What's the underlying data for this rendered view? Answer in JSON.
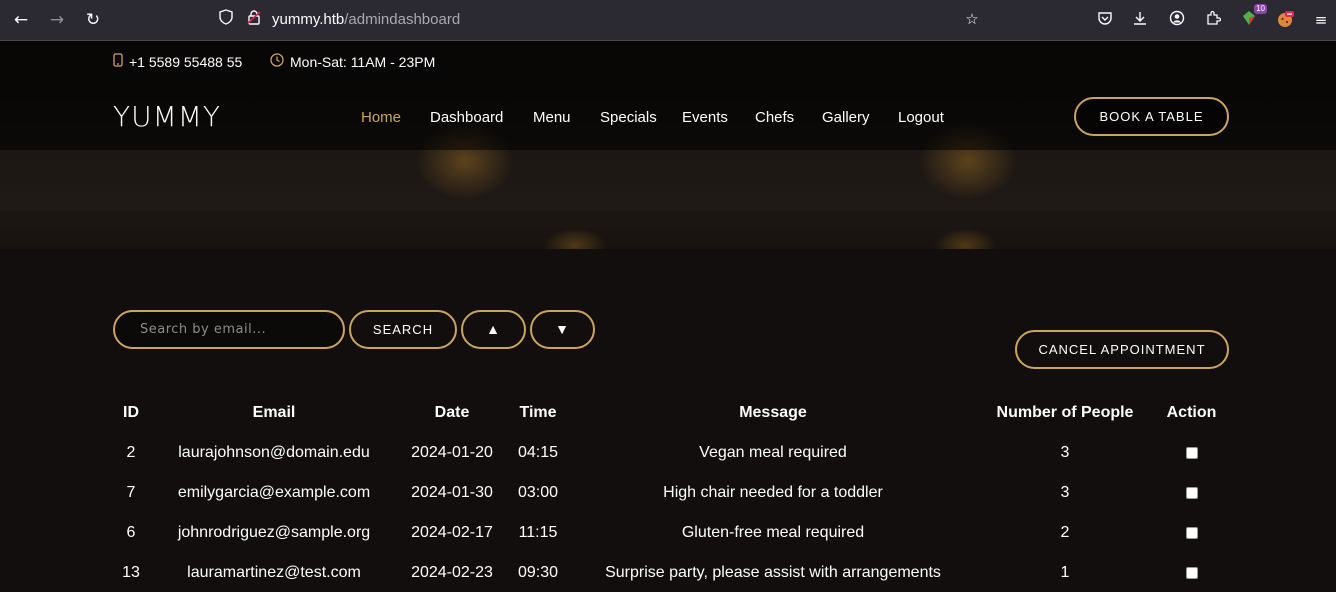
{
  "browser": {
    "url_host": "yummy.htb",
    "url_path": "/admindashboard",
    "extensions_badge": "10"
  },
  "topbar": {
    "phone": "+1 5589 55488 55",
    "hours": "Mon-Sat: 11AM - 23PM"
  },
  "header": {
    "logo": "YUMMY",
    "nav": [
      "Home",
      "Dashboard",
      "Menu",
      "Specials",
      "Events",
      "Chefs",
      "Gallery",
      "Logout"
    ],
    "book_button": "BOOK A TABLE"
  },
  "controls": {
    "search_placeholder": "Search by email...",
    "search_button": "SEARCH",
    "sort_up": "▲",
    "sort_down": "▼",
    "cancel_button": "CANCEL APPOINTMENT"
  },
  "table": {
    "headers": [
      "ID",
      "Email",
      "Date",
      "Time",
      "Message",
      "Number of People",
      "Action"
    ],
    "rows": [
      [
        "2",
        "laurajohnson@domain.edu",
        "2024-01-20",
        "04:15",
        "Vegan meal required",
        "3"
      ],
      [
        "7",
        "emilygarcia@example.com",
        "2024-01-30",
        "03:00",
        "High chair needed for a toddler",
        "3"
      ],
      [
        "6",
        "johnrodriguez@sample.org",
        "2024-02-17",
        "11:15",
        "Gluten-free meal required",
        "2"
      ],
      [
        "13",
        "lauramartinez@test.com",
        "2024-02-23",
        "09:30",
        "Surprise party, please assist with arrangements",
        "1"
      ]
    ]
  },
  "colors": {
    "accent": "#cda45e",
    "background": "#0c0a09",
    "browser_chrome": "#2b2a33"
  }
}
